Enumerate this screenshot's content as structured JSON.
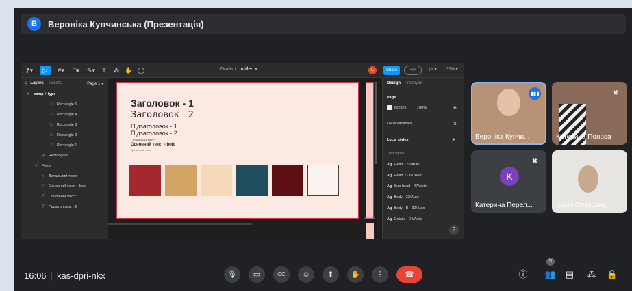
{
  "presenter": {
    "avatar_letter": "В",
    "title": "Вероніка Купчинська (Презентація)"
  },
  "figma": {
    "breadcrumb_folder": "Drafts",
    "breadcrumb_sep": "/",
    "file_name": "Untitled",
    "user_letter": "L",
    "share_label": "Share",
    "code_label": "</>",
    "play_label": "▷ ▾",
    "zoom": "37% ▾",
    "layers_tab": "Layers",
    "assets_tab": "Assets",
    "page_label": "Page 1 ▾",
    "layers": [
      "comp + type",
      "Rectangle 5",
      "Rectangle 4",
      "Rectangle 3",
      "Rectangle 2",
      "Rectangle 1",
      "Rectangle 6",
      "Fonts",
      "Детальний текст",
      "Основний текст - bold",
      "Основний текст",
      "Підзаголовок - 2"
    ],
    "canvas": {
      "heading1": "Заголовок - 1",
      "heading2": "Заголовок - 2",
      "subheading1": "Підзаголовок - 1",
      "subheading2": "Підзаголовок - 2",
      "body": "Основний текст",
      "body_bold": "Основний текст - bold",
      "details": "Детальний текст",
      "search_label": "search",
      "swatch_colors": [
        "#a3282d",
        "#d3a565",
        "#f5d9b8",
        "#1f4f5c",
        "#5b0f13",
        "#fbf3ef"
      ]
    },
    "design_tab": "Design",
    "prototype_tab": "Prototype",
    "page_section": "Page",
    "page_color": "292929",
    "page_opacity": "100%",
    "local_variables": "Local variables",
    "local_styles": "Local styles",
    "text_styles": "Text styles",
    "styles": [
      "Head · 70/Auto",
      "Head 2 · 61/Auto",
      "Sub-head · 47/Auto",
      "Body · 32/Auto",
      "Body - B · 32/Auto",
      "Details · 24/Auto"
    ],
    "style_prefix": "Ag",
    "help": "?"
  },
  "participants": [
    {
      "name": "Вероніка Купчи...",
      "speaking": true
    },
    {
      "name": "Катерина Попова",
      "muted": true
    },
    {
      "name": "Катерина Перел...",
      "avatar_letter": "K",
      "muted": true
    },
    {
      "name": "Ірина Олександ..."
    }
  ],
  "meeting": {
    "time": "16:06",
    "code": "kas-dpri-nkx",
    "people_count": "5"
  },
  "icons": {
    "mic": "🎙",
    "camera": "▭",
    "captions": "CC",
    "emoji": "☺",
    "present": "⬆",
    "hand": "✋",
    "more": "⋮",
    "end": "☎",
    "info": "ⓘ",
    "people": "👥",
    "chat": "▤",
    "activities": "⁂",
    "host": "🔒"
  },
  "colors": {
    "accent": "#1a73e8",
    "end_call": "#ea4335",
    "figma_blue": "#0d99ff",
    "background": "#202124"
  }
}
